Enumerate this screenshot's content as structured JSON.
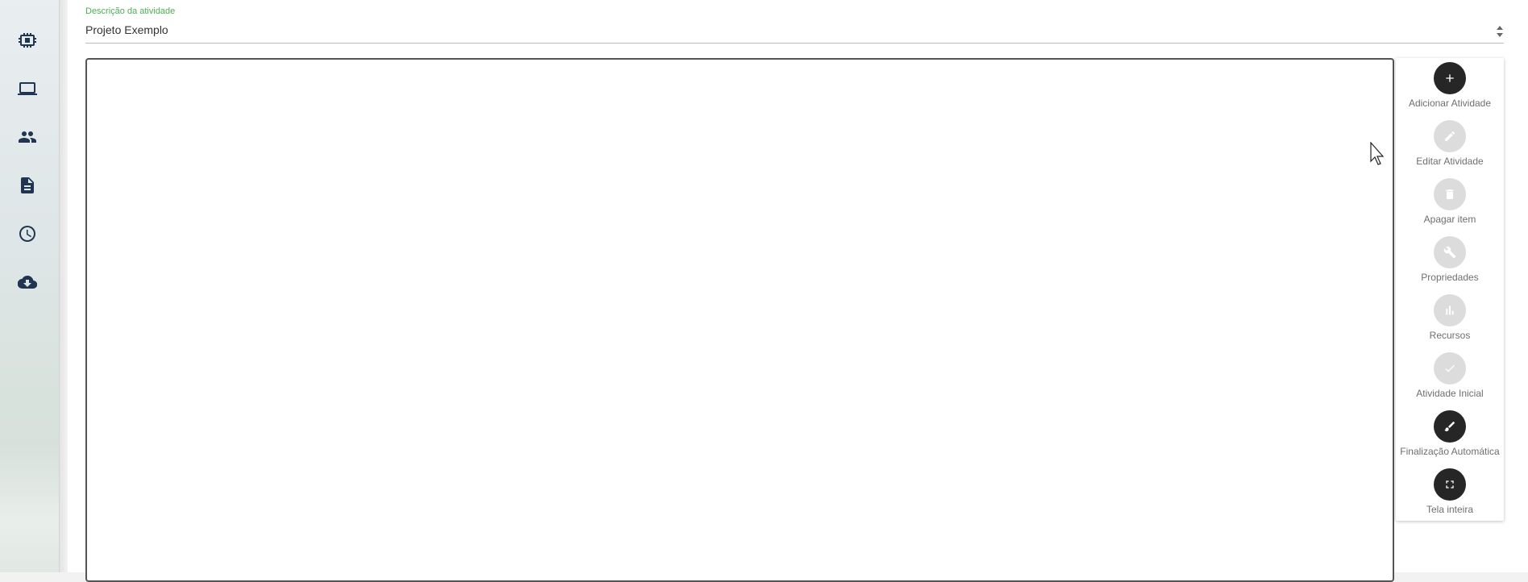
{
  "sidebar": {
    "items": [
      {
        "icon": "chip-icon"
      },
      {
        "icon": "laptop-icon"
      },
      {
        "icon": "people-icon"
      },
      {
        "icon": "document-icon"
      },
      {
        "icon": "clock-icon"
      },
      {
        "icon": "cloud-download-icon"
      }
    ]
  },
  "description_field": {
    "label": "Descrição da atividade",
    "value": "Projeto Exemplo"
  },
  "toolbar": {
    "items": [
      {
        "label": "Adicionar Atividade",
        "icon": "plus-icon",
        "state": "active"
      },
      {
        "label": "Editar Atividade",
        "icon": "pencil-icon",
        "state": "disabled"
      },
      {
        "label": "Apagar item",
        "icon": "trash-icon",
        "state": "disabled"
      },
      {
        "label": "Propriedades",
        "icon": "wrench-icon",
        "state": "disabled"
      },
      {
        "label": "Recursos",
        "icon": "bar-chart-icon",
        "state": "disabled"
      },
      {
        "label": "Atividade Inicial",
        "icon": "check-icon",
        "state": "disabled"
      },
      {
        "label": "Finalização Automática",
        "icon": "brush-icon",
        "state": "active"
      },
      {
        "label": "Tela inteira",
        "icon": "fullscreen-icon",
        "state": "active"
      }
    ]
  },
  "colors": {
    "accent_label": "#4caf50",
    "active_button": "#262626",
    "disabled_button": "#dcdcdc",
    "sidebar_icon": "#1f3550"
  }
}
